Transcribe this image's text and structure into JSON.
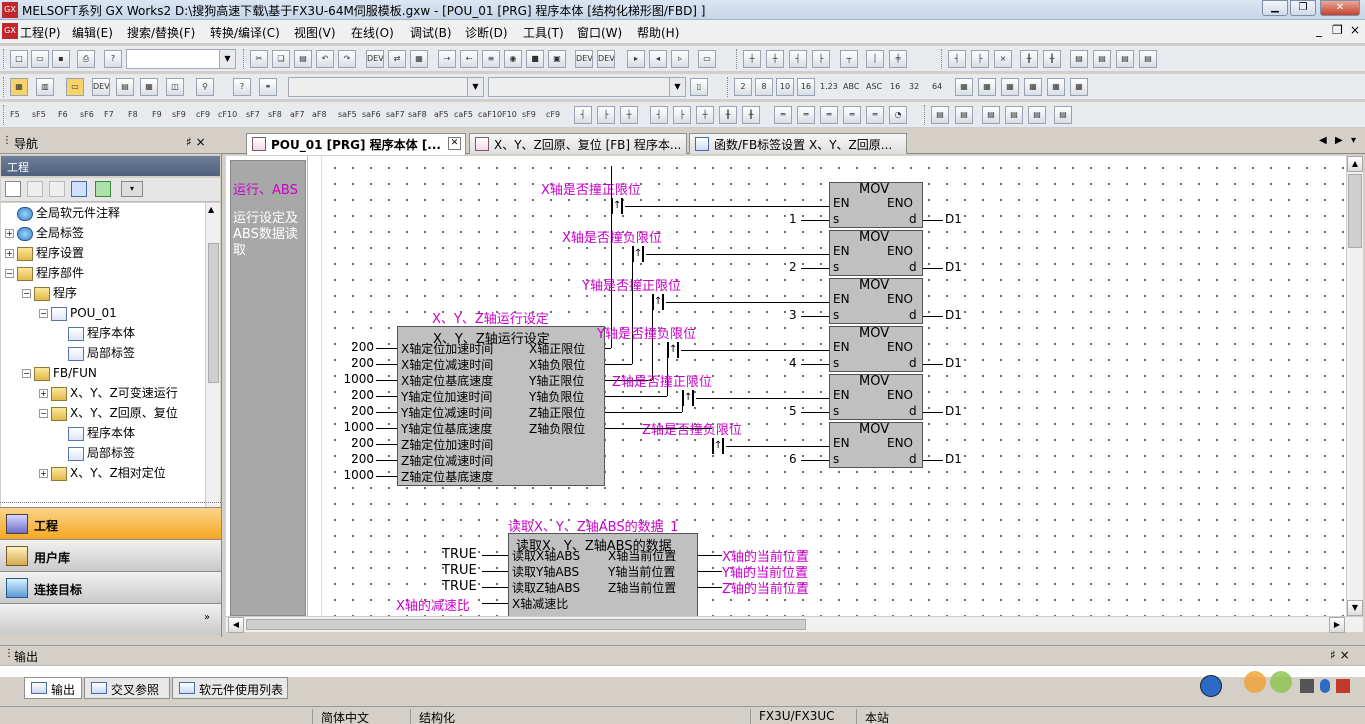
{
  "window": {
    "title": "MELSOFT系列 GX Works2 D:\\搜狗高速下载\\基于FX3U-64M伺服模板.gxw - [POU_01 [PRG] 程序本体 [结构化梯形图/FBD] ]",
    "app_icon_text": "GX"
  },
  "menu": [
    "工程(P)",
    "编辑(E)",
    "搜索/替换(F)",
    "转换/编译(C)",
    "视图(V)",
    "在线(O)",
    "调试(B)",
    "诊断(D)",
    "工具(T)",
    "窗口(W)",
    "帮助(H)"
  ],
  "toolbar": {
    "device_labels": [
      "DEV",
      "DEV",
      "DEV",
      "DEV"
    ],
    "display_items": [
      "2",
      "8",
      "10",
      "16",
      "1.23",
      "ABC",
      "ASC",
      "16",
      "32",
      "64"
    ],
    "fkeys": [
      "F5",
      "sF5",
      "F6",
      "sF6",
      "F7",
      "F8",
      "F9",
      "sF9",
      "cF9",
      "cF10",
      "sF7",
      "sF8",
      "aF7",
      "aF8",
      "saF5",
      "saF6",
      "saF7",
      "saF8",
      "aF5",
      "caF5",
      "caF10",
      "F10",
      "sF9",
      "cF9"
    ]
  },
  "nav": {
    "title": "导航",
    "pin": "♯ ×",
    "project_header": "工程",
    "tree": [
      {
        "label": "全局软元件注释",
        "level": 0,
        "expand": "",
        "icon": "globe"
      },
      {
        "label": "全局标签",
        "level": 0,
        "expand": "+",
        "icon": "globe"
      },
      {
        "label": "程序设置",
        "level": 0,
        "expand": "+",
        "icon": "folder"
      },
      {
        "label": "程序部件",
        "level": 0,
        "expand": "−",
        "icon": "folder"
      },
      {
        "label": "程序",
        "level": 1,
        "expand": "−",
        "icon": "folder"
      },
      {
        "label": "POU_01",
        "level": 2,
        "expand": "−",
        "icon": "doc"
      },
      {
        "label": "程序本体",
        "level": 3,
        "expand": "",
        "icon": "doc"
      },
      {
        "label": "局部标签",
        "level": 3,
        "expand": "",
        "icon": "doc"
      },
      {
        "label": "FB/FUN",
        "level": 1,
        "expand": "−",
        "icon": "folder"
      },
      {
        "label": "X、Y、Z可变速运行",
        "level": 2,
        "expand": "+",
        "icon": "folder"
      },
      {
        "label": "X、Y、Z回原、复位",
        "level": 2,
        "expand": "−",
        "icon": "folder"
      },
      {
        "label": "程序本体",
        "level": 3,
        "expand": "",
        "icon": "doc"
      },
      {
        "label": "局部标签",
        "level": 3,
        "expand": "",
        "icon": "doc"
      },
      {
        "label": "X、Y、Z相对定位",
        "level": 2,
        "expand": "+",
        "icon": "folder"
      }
    ],
    "buttons": [
      "工程",
      "用户库",
      "连接目标"
    ]
  },
  "tabs": [
    {
      "label": "POU_01 [PRG] 程序本体 [...",
      "active": true
    },
    {
      "label": "X、Y、Z回原、复位 [FB] 程序本...",
      "active": false
    },
    {
      "label": "函数/FB标签设置 X、Y、Z回原...",
      "active": false
    }
  ],
  "editor": {
    "comment_title": "运行、ABS",
    "comment_body": "运行设定及ABS数据读取",
    "fb1": {
      "instance": "X、Y、Z轴运行设定",
      "name": "X、Y、Z轴运行设定",
      "inputs": [
        {
          "value": "200",
          "pin": "X轴定位加速时间"
        },
        {
          "value": "200",
          "pin": "X轴定位减速时间"
        },
        {
          "value": "1000",
          "pin": "X轴定位基底速度"
        },
        {
          "value": "200",
          "pin": "Y轴定位加速时间"
        },
        {
          "value": "200",
          "pin": "Y轴定位减速时间"
        },
        {
          "value": "1000",
          "pin": "Y轴定位基底速度"
        },
        {
          "value": "200",
          "pin": "Z轴定位加速时间"
        },
        {
          "value": "200",
          "pin": "Z轴定位减速时间"
        },
        {
          "value": "1000",
          "pin": "Z轴定位基底速度"
        }
      ],
      "outputs": [
        "X轴正限位",
        "X轴负限位",
        "Y轴正限位",
        "Y轴负限位",
        "Z轴正限位",
        "Z轴负限位"
      ]
    },
    "contacts": [
      "X轴是否撞正限位",
      "X轴是否撞负限位",
      "Y轴是否撞正限位",
      "Y轴是否撞负限位",
      "Z轴是否撞正限位",
      "Z轴是否撞负限位"
    ],
    "contact_symbol": "↑",
    "movs": [
      {
        "s": "1",
        "d": "D1"
      },
      {
        "s": "2",
        "d": "D1"
      },
      {
        "s": "3",
        "d": "D1"
      },
      {
        "s": "4",
        "d": "D1"
      },
      {
        "s": "5",
        "d": "D1"
      },
      {
        "s": "6",
        "d": "D1"
      }
    ],
    "mov_pins": {
      "name": "MOV",
      "en": "EN",
      "eno": "ENO",
      "s": "s",
      "d": "d"
    },
    "fb2": {
      "instance": "读取X、Y、Z轴ABS的数据_1",
      "name": "读取X、Y、Z轴ABS的数据",
      "inputs": [
        {
          "value": "TRUE",
          "pin": "读取X轴ABS"
        },
        {
          "value": "TRUE",
          "pin": "读取Y轴ABS"
        },
        {
          "value": "TRUE",
          "pin": "读取Z轴ABS"
        },
        {
          "value": "X轴的减速比",
          "pin": "X轴减速比"
        }
      ],
      "outputs": [
        {
          "pin": "X轴当前位置",
          "var": "X轴的当前位置"
        },
        {
          "pin": "Y轴当前位置",
          "var": "Y轴的当前位置"
        },
        {
          "pin": "Z轴当前位置",
          "var": "Z轴的当前位置"
        }
      ]
    }
  },
  "output": {
    "title": "输出",
    "tabs": [
      "输出",
      "交叉参照",
      "软元件使用列表"
    ]
  },
  "status": {
    "lang": "简体中文",
    "mode": "结构化",
    "cpu": "FX3U/FX3UC",
    "station": "本站"
  },
  "colors": {
    "accent_orange": "#f7a830",
    "pink": "#cc00cc",
    "block_gray": "#c0c0c0"
  }
}
